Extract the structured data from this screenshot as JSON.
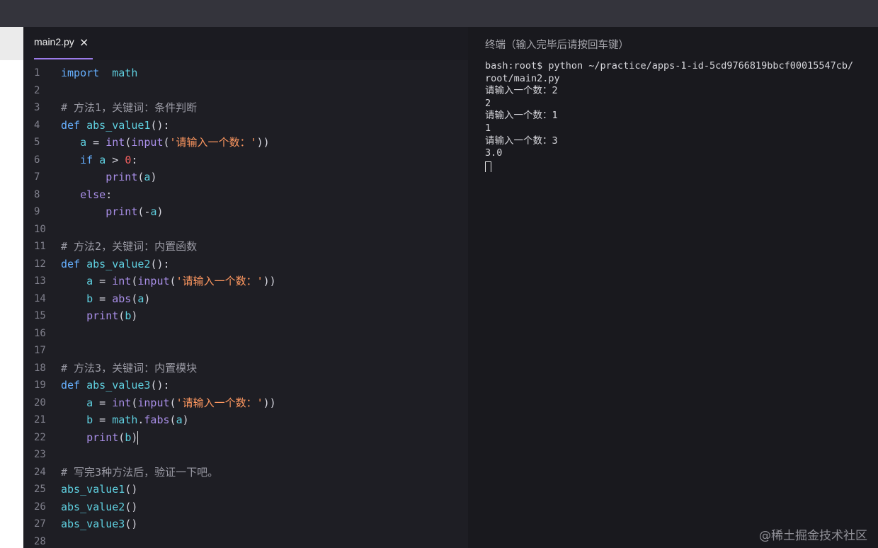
{
  "tab": {
    "filename": "main2.py",
    "close_glyph": "×"
  },
  "code_lines": [
    {
      "n": "1",
      "tokens": [
        [
          "kw",
          "import"
        ],
        [
          "",
          "  "
        ],
        [
          "fn",
          "math"
        ]
      ]
    },
    {
      "n": "2",
      "tokens": []
    },
    {
      "n": "3",
      "tokens": [
        [
          "cm",
          "# 方法1，关键词：条件判断"
        ]
      ]
    },
    {
      "n": "4",
      "tokens": [
        [
          "kw",
          "def"
        ],
        [
          "",
          " "
        ],
        [
          "fn",
          "abs_value1"
        ],
        [
          "",
          "():"
        ]
      ]
    },
    {
      "n": "5",
      "tokens": [
        [
          "",
          "   "
        ],
        [
          "fn",
          "a"
        ],
        [
          "",
          " = "
        ],
        [
          "call",
          "int"
        ],
        [
          "",
          "("
        ],
        [
          "call",
          "input"
        ],
        [
          "",
          "("
        ],
        [
          "str",
          "'请输入一个数："
        ],
        [
          "str",
          "'"
        ],
        [
          "",
          "))"
        ]
      ]
    },
    {
      "n": "6",
      "tokens": [
        [
          "",
          "   "
        ],
        [
          "kw",
          "if"
        ],
        [
          "",
          " "
        ],
        [
          "fn",
          "a"
        ],
        [
          "",
          " > "
        ],
        [
          "num",
          "0"
        ],
        [
          "",
          ":"
        ]
      ]
    },
    {
      "n": "7",
      "tokens": [
        [
          "",
          "       "
        ],
        [
          "call",
          "print"
        ],
        [
          "",
          "("
        ],
        [
          "fn",
          "a"
        ],
        [
          "",
          ")"
        ]
      ]
    },
    {
      "n": "8",
      "tokens": [
        [
          "",
          "   "
        ],
        [
          "call",
          "else"
        ],
        [
          "",
          ":"
        ]
      ]
    },
    {
      "n": "9",
      "tokens": [
        [
          "",
          "       "
        ],
        [
          "call",
          "print"
        ],
        [
          "",
          "(-"
        ],
        [
          "fn",
          "a"
        ],
        [
          "",
          ")"
        ]
      ]
    },
    {
      "n": "10",
      "tokens": []
    },
    {
      "n": "11",
      "tokens": [
        [
          "cm",
          "# 方法2，关键词：内置函数"
        ]
      ]
    },
    {
      "n": "12",
      "tokens": [
        [
          "kw",
          "def"
        ],
        [
          "",
          " "
        ],
        [
          "fn",
          "abs_value2"
        ],
        [
          "",
          "():"
        ]
      ]
    },
    {
      "n": "13",
      "tokens": [
        [
          "",
          "    "
        ],
        [
          "fn",
          "a"
        ],
        [
          "",
          " = "
        ],
        [
          "call",
          "int"
        ],
        [
          "",
          "("
        ],
        [
          "call",
          "input"
        ],
        [
          "",
          "("
        ],
        [
          "str",
          "'请输入一个数："
        ],
        [
          "str",
          "'"
        ],
        [
          "",
          "))"
        ]
      ]
    },
    {
      "n": "14",
      "tokens": [
        [
          "",
          "    "
        ],
        [
          "fn",
          "b"
        ],
        [
          "",
          " = "
        ],
        [
          "call",
          "abs"
        ],
        [
          "",
          "("
        ],
        [
          "fn",
          "a"
        ],
        [
          "",
          ")"
        ]
      ]
    },
    {
      "n": "15",
      "tokens": [
        [
          "",
          "    "
        ],
        [
          "call",
          "print"
        ],
        [
          "",
          "("
        ],
        [
          "fn",
          "b"
        ],
        [
          "",
          ")"
        ]
      ]
    },
    {
      "n": "16",
      "tokens": []
    },
    {
      "n": "17",
      "tokens": []
    },
    {
      "n": "18",
      "tokens": [
        [
          "cm",
          "# 方法3，关键词：内置模块"
        ]
      ]
    },
    {
      "n": "19",
      "tokens": [
        [
          "kw",
          "def"
        ],
        [
          "",
          " "
        ],
        [
          "fn",
          "abs_value3"
        ],
        [
          "",
          "():"
        ]
      ]
    },
    {
      "n": "20",
      "tokens": [
        [
          "",
          "    "
        ],
        [
          "fn",
          "a"
        ],
        [
          "",
          " = "
        ],
        [
          "call",
          "int"
        ],
        [
          "",
          "("
        ],
        [
          "call",
          "input"
        ],
        [
          "",
          "("
        ],
        [
          "str",
          "'请输入一个数："
        ],
        [
          "str",
          "'"
        ],
        [
          "",
          "))"
        ]
      ]
    },
    {
      "n": "21",
      "tokens": [
        [
          "",
          "    "
        ],
        [
          "fn",
          "b"
        ],
        [
          "",
          " = "
        ],
        [
          "fn",
          "math"
        ],
        [
          "",
          "."
        ],
        [
          "call",
          "fabs"
        ],
        [
          "",
          "("
        ],
        [
          "fn",
          "a"
        ],
        [
          "",
          ")"
        ]
      ]
    },
    {
      "n": "22",
      "tokens": [
        [
          "",
          "    "
        ],
        [
          "call",
          "print"
        ],
        [
          "",
          "("
        ],
        [
          "fn",
          "b"
        ],
        [
          "",
          ")"
        ]
      ],
      "caret": true
    },
    {
      "n": "23",
      "tokens": []
    },
    {
      "n": "24",
      "tokens": [
        [
          "cm",
          "# 写完3种方法后，验证一下吧。"
        ]
      ]
    },
    {
      "n": "25",
      "tokens": [
        [
          "fn",
          "abs_value1"
        ],
        [
          "",
          "()"
        ]
      ]
    },
    {
      "n": "26",
      "tokens": [
        [
          "fn",
          "abs_value2"
        ],
        [
          "",
          "()"
        ]
      ]
    },
    {
      "n": "27",
      "tokens": [
        [
          "fn",
          "abs_value3"
        ],
        [
          "",
          "()"
        ]
      ]
    },
    {
      "n": "28",
      "tokens": []
    }
  ],
  "terminal": {
    "title": "终端（输入完毕后请按回车键）",
    "lines": [
      "bash:root$ python ~/practice/apps-1-id-5cd9766819bbcf00015547cb/",
      "root/main2.py",
      "请输入一个数：2",
      "2",
      "请输入一个数：1",
      "1",
      "请输入一个数：3",
      "3.0"
    ]
  },
  "watermark": "@稀土掘金技术社区"
}
